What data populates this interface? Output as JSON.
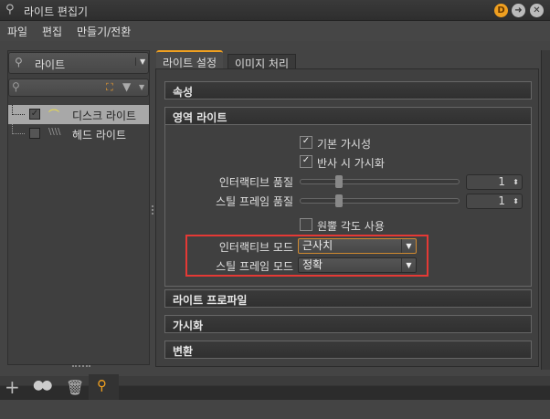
{
  "window": {
    "title": "라이트 편집기",
    "badge": "D"
  },
  "menu": [
    "파일",
    "편집",
    "만들기/전환"
  ],
  "left": {
    "type_combo": "라이트",
    "search_placeholder": "",
    "items": [
      {
        "label": "디스크 라이트",
        "checked": true,
        "selected": true
      },
      {
        "label": "헤드 라이트",
        "checked": false,
        "selected": false
      }
    ]
  },
  "tabs": [
    {
      "label": "라이트 설정",
      "active": true
    },
    {
      "label": "이미지 처리",
      "active": false
    }
  ],
  "sections": {
    "attributes": "속성",
    "area_light": "영역 라이트",
    "light_profile": "라이트 프로파일",
    "visualization": "가시화",
    "transform": "변환"
  },
  "area": {
    "default_visibility": {
      "label": "기본 가시성",
      "checked": true
    },
    "visible_in_reflections": {
      "label": "반사 시 가시화",
      "checked": true
    },
    "interactive_quality": {
      "label": "인터랙티브 품질",
      "value": "1",
      "slider": 0.25
    },
    "still_frame_quality": {
      "label": "스틸 프레임 품질",
      "value": "1",
      "slider": 0.25
    },
    "cone_angle": {
      "label": "원뿔 각도 사용",
      "checked": false
    },
    "interactive_mode": {
      "label": "인터랙티브 모드",
      "value": "근사치"
    },
    "still_frame_mode": {
      "label": "스틸 프레임 모드",
      "value": "정확"
    }
  },
  "colors": {
    "accent": "#f0a020",
    "highlight": "#e53935"
  }
}
